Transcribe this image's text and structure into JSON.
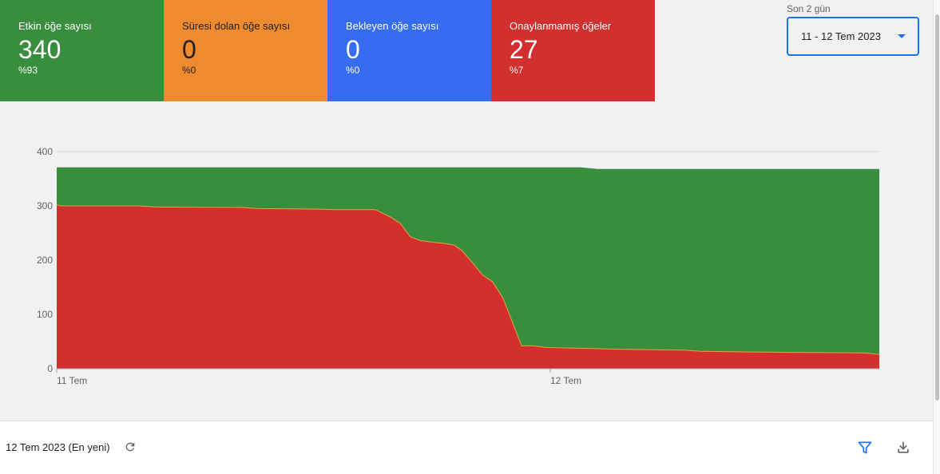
{
  "cards": [
    {
      "label": "Etkin öğe sayısı",
      "value": "340",
      "pct": "%93",
      "color": "#388e3c",
      "text_color": "#ffffff"
    },
    {
      "label": "Süresi dolan öğe sayısı",
      "value": "0",
      "pct": "%0",
      "color": "#ef8a2f",
      "text_color": "#202124"
    },
    {
      "label": "Bekleyen öğe sayısı",
      "value": "0",
      "pct": "%0",
      "color": "#356cf0",
      "text_color": "#ffffff"
    },
    {
      "label": "Onaylanmamış öğeler",
      "value": "27",
      "pct": "%7",
      "color": "#d32f2f",
      "text_color": "#ffffff"
    }
  ],
  "date_picker": {
    "label": "Son 2 gün",
    "value": "11 - 12 Tem 2023"
  },
  "footer": {
    "date_text": "12 Tem 2023 (En yeni)"
  },
  "icons": {
    "refresh": "refresh-icon",
    "filter": "filter-icon",
    "download": "download-icon",
    "dropdown": "dropdown-caret-icon"
  },
  "chart_data": {
    "type": "area",
    "stacked": true,
    "y_ticks": [
      "0",
      "100",
      "200",
      "300",
      "400"
    ],
    "ylim": [
      0,
      400
    ],
    "x_ticks": [
      {
        "label": "11 Tem",
        "x": 0
      },
      {
        "label": "12 Tem",
        "x": 24
      }
    ],
    "xlim": [
      0,
      40
    ],
    "grid": true,
    "series": [
      {
        "color": "#d32f2f",
        "values": [
          [
            0,
            302
          ],
          [
            0.2,
            300
          ],
          [
            4,
            300
          ],
          [
            4.8,
            298
          ],
          [
            9,
            297
          ],
          [
            9.8,
            295
          ],
          [
            12.8,
            294
          ],
          [
            13.5,
            293
          ],
          [
            15.5,
            293
          ],
          [
            16.2,
            280
          ],
          [
            16.7,
            268
          ],
          [
            17.2,
            243
          ],
          [
            17.7,
            236
          ],
          [
            18.3,
            233
          ],
          [
            18.8,
            231
          ],
          [
            19.3,
            228
          ],
          [
            19.7,
            218
          ],
          [
            20.2,
            196
          ],
          [
            20.7,
            173
          ],
          [
            21.2,
            160
          ],
          [
            21.7,
            130
          ],
          [
            22.2,
            82
          ],
          [
            22.6,
            42
          ],
          [
            23.2,
            42
          ],
          [
            23.8,
            39
          ],
          [
            26,
            37
          ],
          [
            27,
            36
          ],
          [
            29,
            35
          ],
          [
            30.6,
            34
          ],
          [
            31.3,
            32
          ],
          [
            33,
            31
          ],
          [
            36,
            30
          ],
          [
            39.3,
            29
          ],
          [
            40,
            26
          ]
        ]
      },
      {
        "color": "#388e3c",
        "values": [
          [
            0,
            371
          ],
          [
            25.5,
            371
          ],
          [
            26.3,
            368
          ],
          [
            40,
            368
          ]
        ]
      }
    ]
  }
}
